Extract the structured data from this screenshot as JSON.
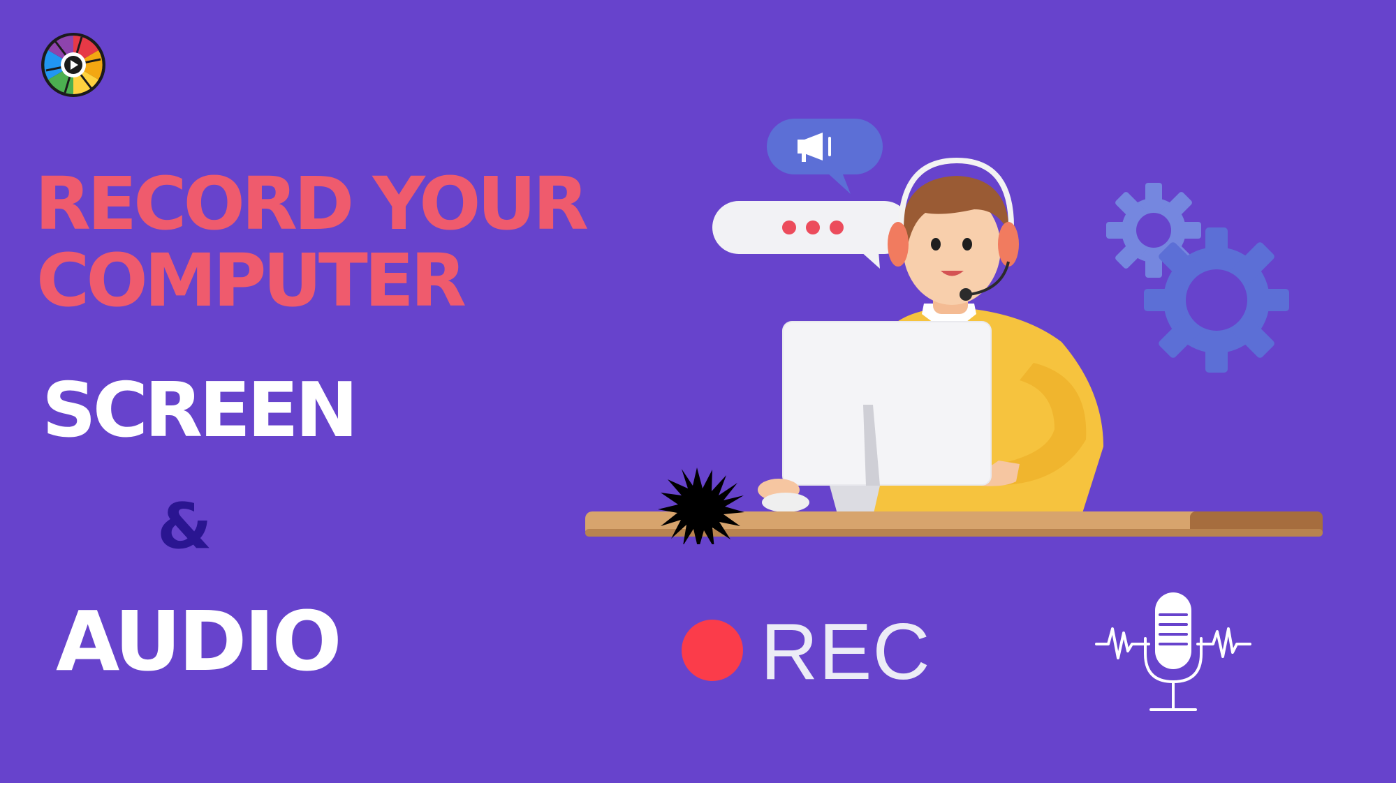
{
  "headline": {
    "line1": "RECORD YOUR",
    "line2": "COMPUTER",
    "line3": "SCREEN",
    "ampersand": "&",
    "line4": "AUDIO"
  },
  "badge": {
    "label": "REC"
  },
  "icons": {
    "logo": "camera-aperture-play-logo",
    "megaphone": "megaphone-icon",
    "typing": "typing-dots-bubble",
    "gears": "gear-icon",
    "starburst": "starburst-icon",
    "record": "record-dot-icon",
    "microphone": "microphone-waveform-icon"
  },
  "colors": {
    "background": "#6743cc",
    "headline_accent": "#ef5b6d",
    "headline_white": "#ffffff",
    "ampersand": "#2a1591",
    "rec_dot": "#fb3c4a",
    "rec_text": "#ececf6",
    "gear": "#6073d8",
    "sweater": "#f6c33e",
    "desk": "#d7a46d"
  }
}
